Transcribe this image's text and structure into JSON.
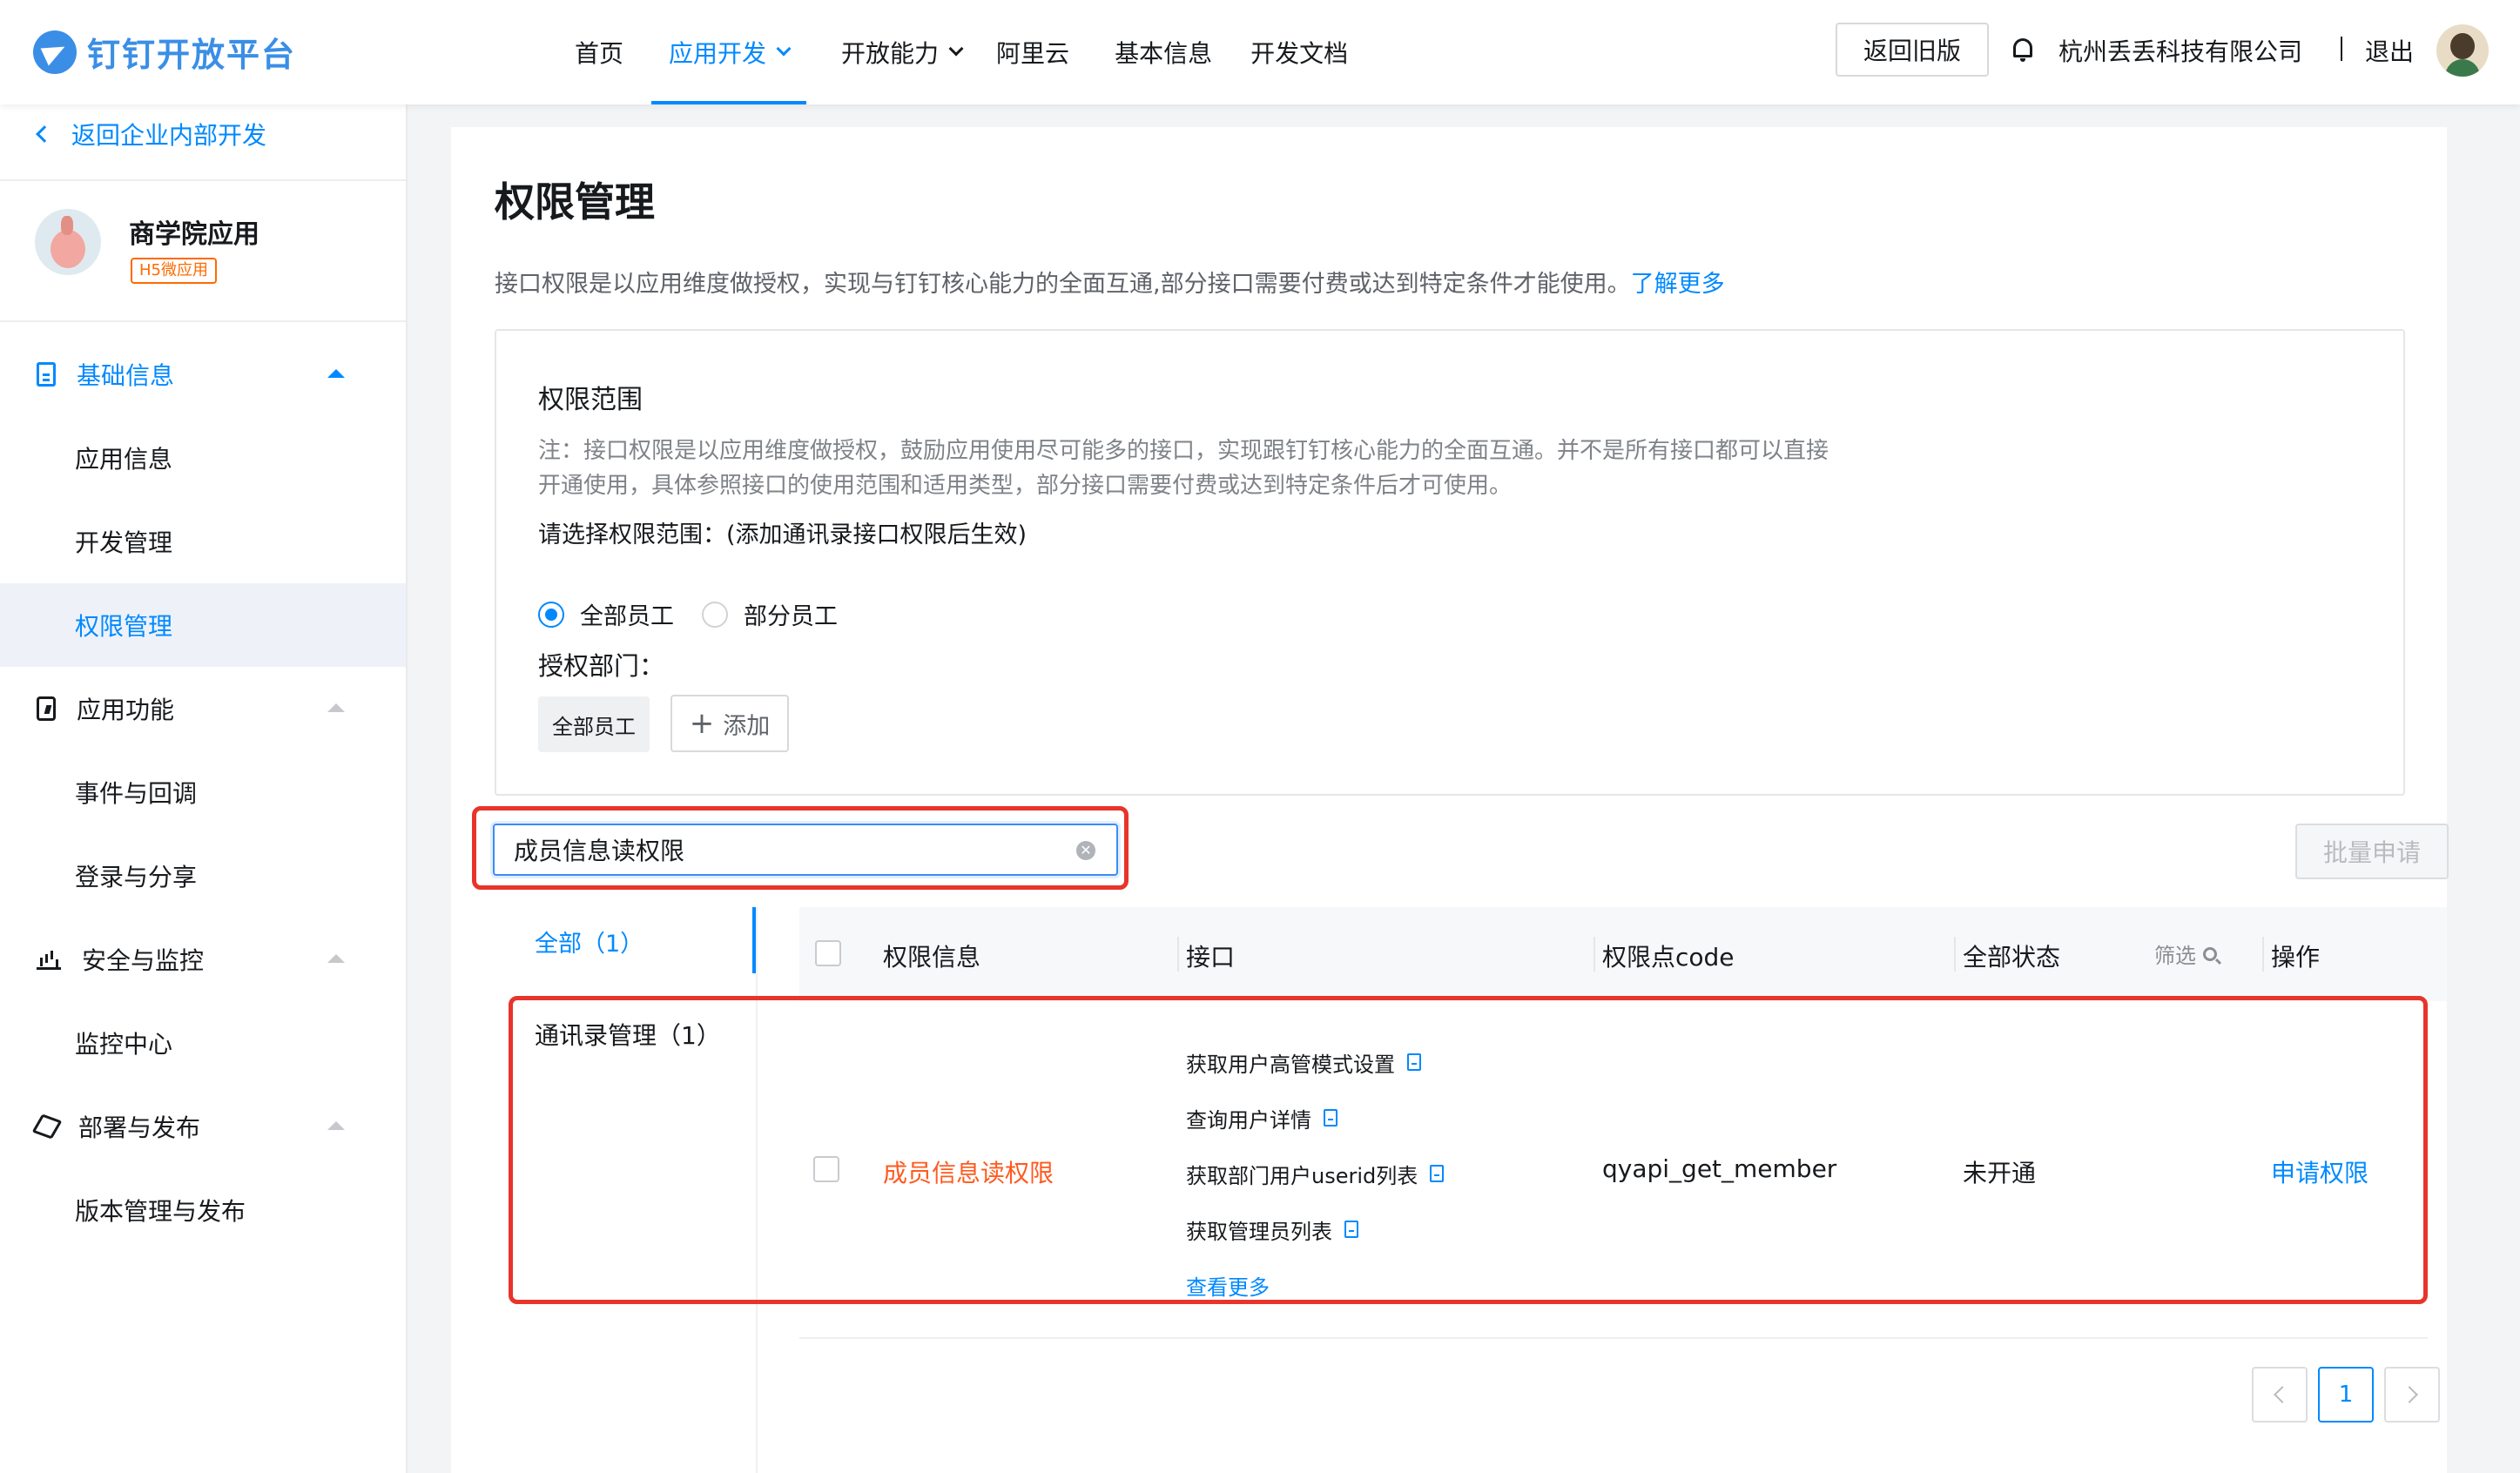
{
  "header": {
    "logo_text": "钉钉开放平台",
    "nav": [
      {
        "label": "首页"
      },
      {
        "label": "应用开发"
      },
      {
        "label": "开放能力"
      },
      {
        "label": "阿里云"
      },
      {
        "label": "基本信息"
      },
      {
        "label": "开发文档"
      }
    ],
    "active_nav": "应用开发",
    "old_version_label": "返回旧版",
    "company": "杭州丢丢科技有限公司",
    "logout_label": "退出"
  },
  "sidebar": {
    "back_label": "返回企业内部开发",
    "app_name": "商学院应用",
    "app_tag": "H5微应用",
    "groups": [
      {
        "label": "基础信息",
        "items": [
          "应用信息",
          "开发管理",
          "权限管理"
        ]
      },
      {
        "label": "应用功能",
        "items": [
          "事件与回调",
          "登录与分享"
        ]
      },
      {
        "label": "安全与监控",
        "items": [
          "监控中心"
        ]
      },
      {
        "label": "部署与发布",
        "items": [
          "版本管理与发布"
        ]
      }
    ],
    "selected_item": "权限管理"
  },
  "main": {
    "title": "权限管理",
    "description": "接口权限是以应用维度做授权，实现与钉钉核心能力的全面互通,部分接口需要付费或达到特定条件才能使用。",
    "learn_more": "了解更多",
    "scope": {
      "title": "权限范围",
      "note": "注：接口权限是以应用维度做授权，鼓励应用使用尽可能多的接口，实现跟钉钉核心能力的全面互通。并不是所有接口都可以直接开通使用，具体参照接口的使用范围和适用类型，部分接口需要付费或达到特定条件后才可使用。",
      "choose_label": "请选择权限范围：(添加通讯录接口权限后生效)",
      "radio_all": "全部员工",
      "radio_part": "部分员工",
      "selected_radio": "全部员工",
      "dept_label": "授权部门：",
      "dept_tag": "全部员工",
      "add_label": "添加"
    },
    "search": {
      "value": "成员信息读权限"
    },
    "batch_label": "批量申请",
    "categories": {
      "all": "全部（1）",
      "contacts": "通讯录管理（1）"
    },
    "table": {
      "headers": {
        "info": "权限信息",
        "api": "接口",
        "code": "权限点code",
        "status": "全部状态",
        "filter": "筛选",
        "action": "操作"
      },
      "row": {
        "name": "成员信息读权限",
        "apis": [
          "获取用户高管模式设置",
          "查询用户详情",
          "获取部门用户userid列表",
          "获取管理员列表"
        ],
        "more": "查看更多",
        "code": "qyapi_get_member",
        "status": "未开通",
        "action": "申请权限"
      }
    },
    "pagination": {
      "current": "1"
    }
  }
}
